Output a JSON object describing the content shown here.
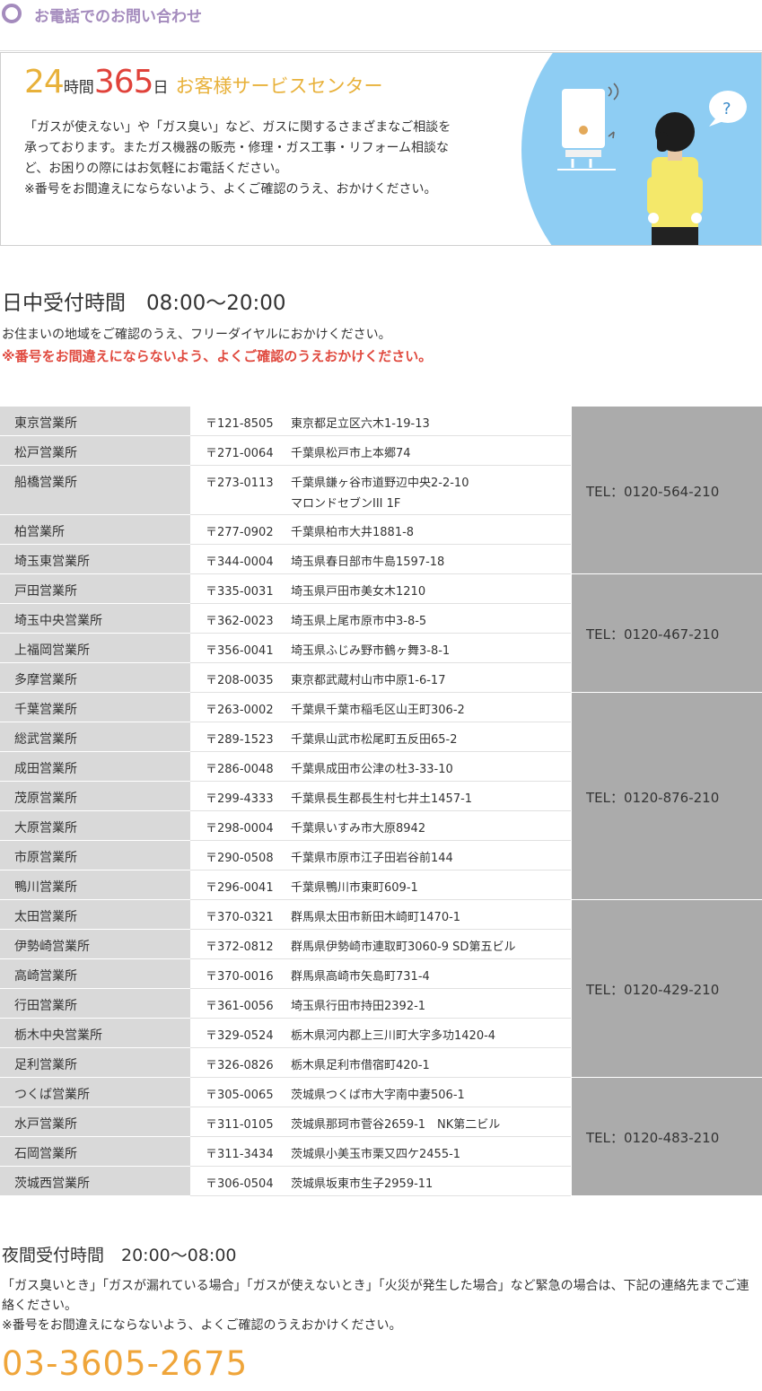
{
  "section_title": "お電話でのお問い合わせ",
  "banner": {
    "hours": "24",
    "hours_unit": "時間",
    "days": "365",
    "days_unit": "日",
    "center_name": "お客様サービスセンター",
    "description": "「ガスが使えない」や「ガス臭い」など、ガスに関するさまざまなご相談を承っております。またガス機器の販売・修理・ガス工事・リフォーム相談など、お困りの際にはお気軽にお電話ください。",
    "note": "※番号をお間違えにならないよう、よくご確認のうえ、おかけください。",
    "illustration_question_mark": "?"
  },
  "daytime": {
    "title": "日中受付時間　08:00～20:00",
    "note": "お住まいの地域をご確認のうえ、フリーダイヤルにおかけください。",
    "warning": "※番号をお間違えにならないよう、よくご確認のうえおかけください。"
  },
  "offices": [
    {
      "name": "東京営業所",
      "zip": "〒121-8505",
      "address": "東京都足立区六木1-19-13"
    },
    {
      "name": "松戸営業所",
      "zip": "〒271-0064",
      "address": "千葉県松戸市上本郷74"
    },
    {
      "name": "船橋営業所",
      "zip": "〒273-0113",
      "address": "千葉県鎌ヶ谷市道野辺中央2-2-10",
      "address2": "マロンドセブンIII 1F"
    },
    {
      "name": "柏営業所",
      "zip": "〒277-0902",
      "address": "千葉県柏市大井1881-8"
    },
    {
      "name": "埼玉東営業所",
      "zip": "〒344-0004",
      "address": "埼玉県春日部市牛島1597-18"
    },
    {
      "name": "戸田営業所",
      "zip": "〒335-0031",
      "address": "埼玉県戸田市美女木1210"
    },
    {
      "name": "埼玉中央営業所",
      "zip": "〒362-0023",
      "address": "埼玉県上尾市原市中3-8-5"
    },
    {
      "name": "上福岡営業所",
      "zip": "〒356-0041",
      "address": "埼玉県ふじみ野市鶴ヶ舞3-8-1"
    },
    {
      "name": "多摩営業所",
      "zip": "〒208-0035",
      "address": "東京都武蔵村山市中原1-6-17"
    },
    {
      "name": "千葉営業所",
      "zip": "〒263-0002",
      "address": "千葉県千葉市稲毛区山王町306-2"
    },
    {
      "name": "総武営業所",
      "zip": "〒289-1523",
      "address": "千葉県山武市松尾町五反田65-2"
    },
    {
      "name": "成田営業所",
      "zip": "〒286-0048",
      "address": "千葉県成田市公津の杜3-33-10"
    },
    {
      "name": "茂原営業所",
      "zip": "〒299-4333",
      "address": "千葉県長生郡長生村七井土1457-1"
    },
    {
      "name": "大原営業所",
      "zip": "〒298-0004",
      "address": "千葉県いすみ市大原8942"
    },
    {
      "name": "市原営業所",
      "zip": "〒290-0508",
      "address": "千葉県市原市江子田岩谷前144"
    },
    {
      "name": "鴨川営業所",
      "zip": "〒296-0041",
      "address": "千葉県鴨川市東町609-1"
    },
    {
      "name": "太田営業所",
      "zip": "〒370-0321",
      "address": "群馬県太田市新田木崎町1470-1"
    },
    {
      "name": "伊勢崎営業所",
      "zip": "〒372-0812",
      "address": "群馬県伊勢崎市連取町3060-9 SD第五ビル"
    },
    {
      "name": "高崎営業所",
      "zip": "〒370-0016",
      "address": "群馬県高崎市矢島町731-4"
    },
    {
      "name": "行田営業所",
      "zip": "〒361-0056",
      "address": "埼玉県行田市持田2392-1"
    },
    {
      "name": "栃木中央営業所",
      "zip": "〒329-0524",
      "address": "栃木県河内郡上三川町大字多功1420-4"
    },
    {
      "name": "足利営業所",
      "zip": "〒326-0826",
      "address": "栃木県足利市借宿町420-1"
    },
    {
      "name": "つくば営業所",
      "zip": "〒305-0065",
      "address": "茨城県つくば市大字南中妻506-1"
    },
    {
      "name": "水戸営業所",
      "zip": "〒311-0105",
      "address": "茨城県那珂市菅谷2659-1　NK第二ビル"
    },
    {
      "name": "石岡営業所",
      "zip": "〒311-3434",
      "address": "茨城県小美玉市栗又四ケ2455-1"
    },
    {
      "name": "茨城西営業所",
      "zip": "〒306-0504",
      "address": "茨城県坂東市生子2959-11"
    }
  ],
  "tel_groups": [
    {
      "label": "TEL：0120-564-210",
      "first": 0,
      "last": 4
    },
    {
      "label": "TEL：0120-467-210",
      "first": 5,
      "last": 8
    },
    {
      "label": "TEL：0120-876-210",
      "first": 9,
      "last": 15
    },
    {
      "label": "TEL：0120-429-210",
      "first": 16,
      "last": 21
    },
    {
      "label": "TEL：0120-483-210",
      "first": 22,
      "last": 25
    }
  ],
  "night": {
    "title": "夜間受付時間　20:00～08:00",
    "description": "「ガス臭いとき」「ガスが漏れている場合」「ガスが使えないとき」「火災が発生した場合」など緊急の場合は、下記の連絡先までご連絡ください。",
    "note": "※番号をお間違えにならないよう、よくご確認のうえおかけください。",
    "phone": "03-3605-2675"
  },
  "colors": {
    "accent_purple": "#a48bbd",
    "accent_orange": "#e8b13a",
    "accent_red": "#e0423a",
    "warning_red": "#e04a3f",
    "banner_blue": "#8ecdf3",
    "name_cell": "#d9d9d9",
    "tel_cell": "#ababab",
    "night_phone": "#efa53a"
  }
}
